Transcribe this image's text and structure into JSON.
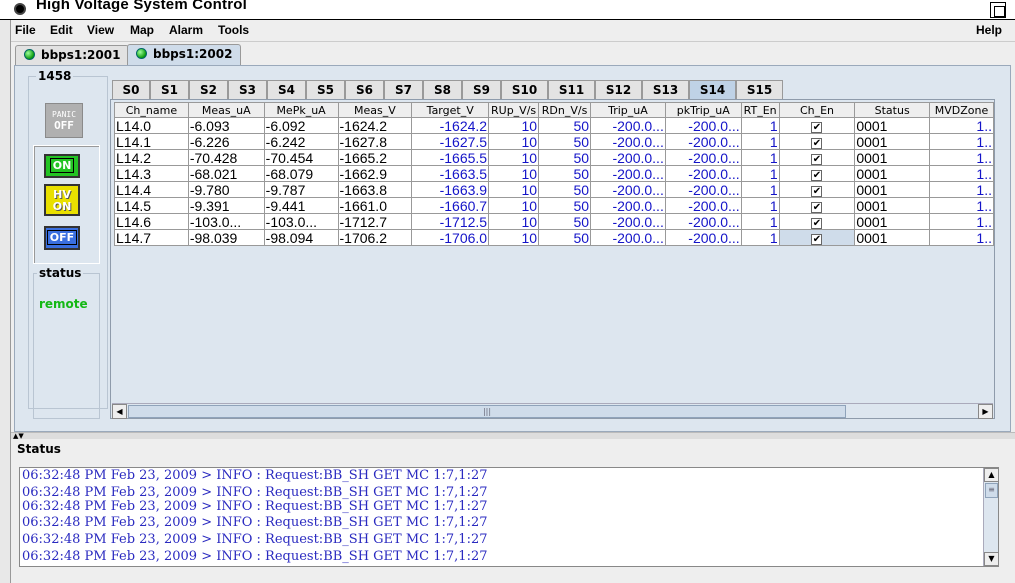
{
  "window": {
    "title": "High Voltage System Control"
  },
  "menu": [
    {
      "label": "File",
      "key": "F"
    },
    {
      "label": "Edit",
      "key": "E"
    },
    {
      "label": "View",
      "key": "V"
    },
    {
      "label": "Map",
      "key": "M"
    },
    {
      "label": "Alarm",
      "key": "A"
    },
    {
      "label": "Tools",
      "key": "T"
    }
  ],
  "menu_help": "Help",
  "crate_tabs": [
    {
      "label": "bbps1:2001",
      "selected": false
    },
    {
      "label": "bbps1:2002",
      "selected": true
    }
  ],
  "left_panel": {
    "crate_id": "1458",
    "panic_top": "PANIC",
    "panic_bottom": "OFF",
    "on_label": "ON",
    "hv_on_line1": "HV",
    "hv_on_line2": "ON",
    "off_label": "OFF",
    "status_title": "status",
    "status_value": "remote"
  },
  "slot_tabs": [
    "S0",
    "S1",
    "S2",
    "S3",
    "S4",
    "S5",
    "S6",
    "S7",
    "S8",
    "S9",
    "S10",
    "S11",
    "S12",
    "S13",
    "S14",
    "S15"
  ],
  "selected_slot": "S14",
  "table": {
    "columns": [
      "Ch_name",
      "Meas_uA",
      "MePk_uA",
      "Meas_V",
      "Target_V",
      "RUp_V/s",
      "RDn_V/s",
      "Trip_uA",
      "pkTrip_uA",
      "RT_En",
      "Ch_En",
      "Status",
      "MVDZone"
    ],
    "rows": [
      [
        "L14.0",
        "-6.093",
        "-6.092",
        "-1624.2",
        "-1624.2",
        "10",
        "50",
        "-200.0...",
        "-200.0...",
        "1",
        "✔",
        "0001",
        "1.."
      ],
      [
        "L14.1",
        "-6.226",
        "-6.242",
        "-1627.8",
        "-1627.5",
        "10",
        "50",
        "-200.0...",
        "-200.0...",
        "1",
        "✔",
        "0001",
        "1.."
      ],
      [
        "L14.2",
        "-70.428",
        "-70.454",
        "-1665.2",
        "-1665.5",
        "10",
        "50",
        "-200.0...",
        "-200.0...",
        "1",
        "✔",
        "0001",
        "1.."
      ],
      [
        "L14.3",
        "-68.021",
        "-68.079",
        "-1662.9",
        "-1663.5",
        "10",
        "50",
        "-200.0...",
        "-200.0...",
        "1",
        "✔",
        "0001",
        "1.."
      ],
      [
        "L14.4",
        "-9.780",
        "-9.787",
        "-1663.8",
        "-1663.9",
        "10",
        "50",
        "-200.0...",
        "-200.0...",
        "1",
        "✔",
        "0001",
        "1.."
      ],
      [
        "L14.5",
        "-9.391",
        "-9.441",
        "-1661.0",
        "-1660.7",
        "10",
        "50",
        "-200.0...",
        "-200.0...",
        "1",
        "✔",
        "0001",
        "1.."
      ],
      [
        "L14.6",
        "-103.0...",
        "-103.0...",
        "-1712.7",
        "-1712.5",
        "10",
        "50",
        "-200.0...",
        "-200.0...",
        "1",
        "✔",
        "0001",
        "1.."
      ],
      [
        "L14.7",
        "-98.039",
        "-98.094",
        "-1706.2",
        "-1706.0",
        "10",
        "50",
        "-200.0...",
        "-200.0...",
        "1",
        "✔",
        "0001",
        "1.."
      ]
    ]
  },
  "status_panel": {
    "title": "Status",
    "log": [
      "06:32:48 PM Feb 23, 2009 > INFO : Request:BB_SH GET MC 1:7,1:27",
      "06:32:48 PM Feb 23, 2009 > INFO : Request:BB_SH GET MC 1:7,1:27",
      "06:32:48 PM Feb 23, 2009 > INFO : Request:BB_SH GET MC 1:7,1:27",
      "06:32:48 PM Feb 23, 2009 > INFO : Request:BB_SH GET MC 1:7,1:27",
      "06:32:48 PM Feb 23, 2009 > INFO : Request:BB_SH GET MC 1:7,1:27",
      "06:32:48 PM Feb 23, 2009 > INFO : Request:BB_SH GET MC 1:7,1:27",
      "06:32:48 PM Feb 23, 2009 > INFO : Request:BB_SH GET MC 1:7,1:27",
      "06:32:48 PM Feb 23, 2009 > INFO : Request:BB_SH GET MC 1:7,1:27"
    ]
  },
  "colors": {
    "value_blue": "#1414c8",
    "remote_green": "#14b814",
    "log_blue": "#2a2ac0"
  }
}
